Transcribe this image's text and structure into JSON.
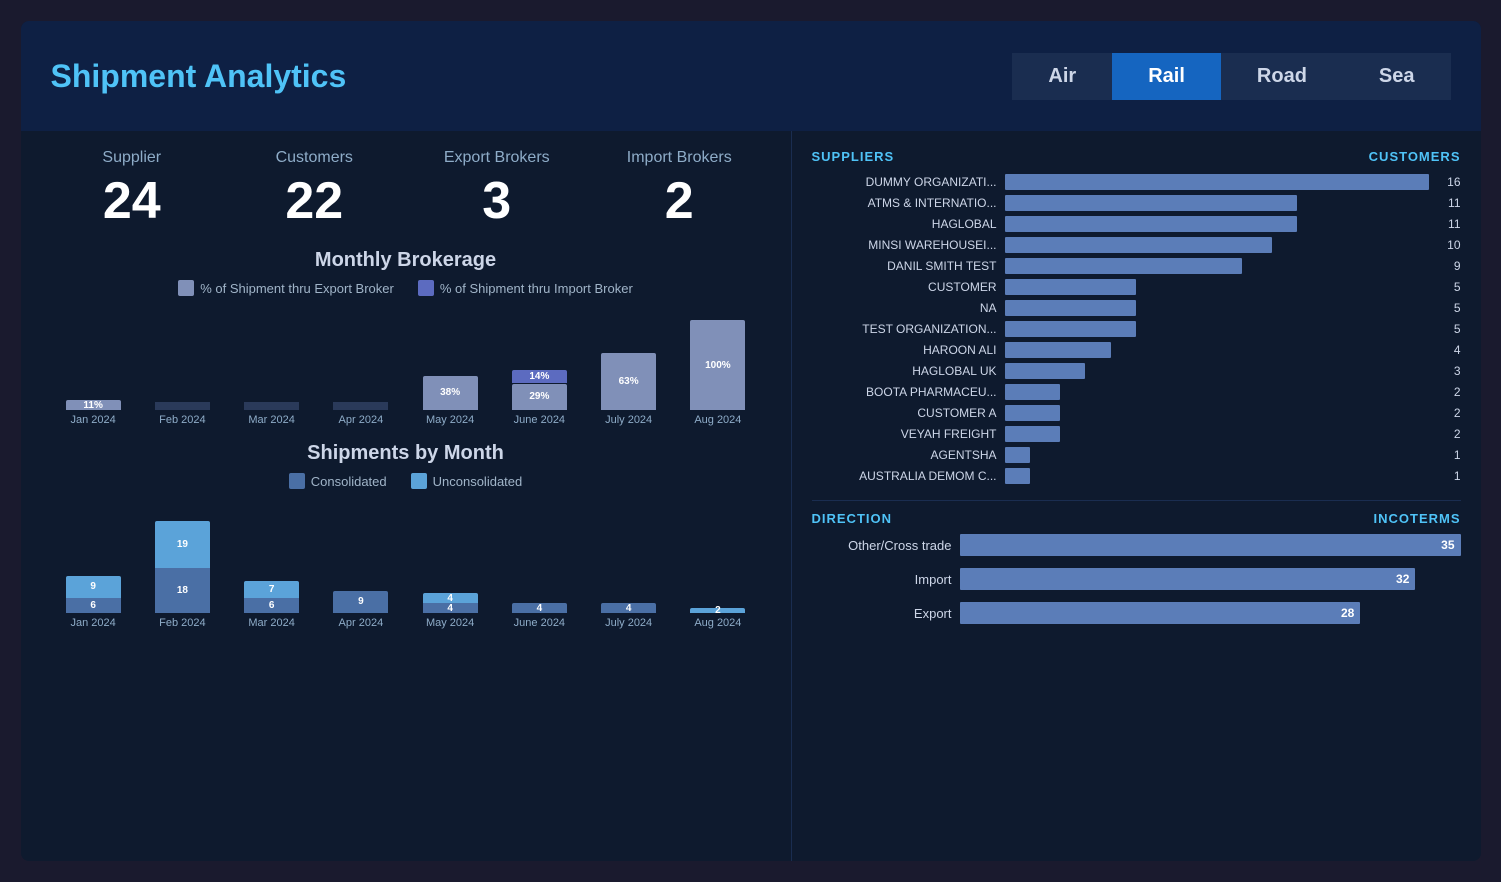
{
  "header": {
    "title": "Shipment Analytics",
    "nav_tabs": [
      {
        "label": "Air",
        "active": false
      },
      {
        "label": "Rail",
        "active": true
      },
      {
        "label": "Road",
        "active": false
      },
      {
        "label": "Sea",
        "active": false
      }
    ]
  },
  "stats": [
    {
      "label": "Supplier",
      "value": "24"
    },
    {
      "label": "Customers",
      "value": "22"
    },
    {
      "label": "Export Brokers",
      "value": "3"
    },
    {
      "label": "Import Brokers",
      "value": "2"
    }
  ],
  "brokerage_chart": {
    "title": "Monthly Brokerage",
    "legend": [
      {
        "label": "% of Shipment thru Export Broker",
        "color": "#8090b8"
      },
      {
        "label": "% of Shipment thru Import Broker",
        "color": "#5c6bc0"
      }
    ],
    "bars": [
      {
        "month": "Jan 2024",
        "export_pct": 11,
        "import_pct": 0,
        "export_label": "11%",
        "import_label": ""
      },
      {
        "month": "Feb 2024",
        "export_pct": 0,
        "import_pct": 0,
        "export_label": "",
        "import_label": ""
      },
      {
        "month": "Mar 2024",
        "export_pct": 0,
        "import_pct": 0,
        "export_label": "",
        "import_label": ""
      },
      {
        "month": "Apr 2024",
        "export_pct": 0,
        "import_pct": 0,
        "export_label": "",
        "import_label": ""
      },
      {
        "month": "May 2024",
        "export_pct": 38,
        "import_pct": 0,
        "export_label": "38%",
        "import_label": ""
      },
      {
        "month": "June 2024",
        "export_pct": 29,
        "import_pct": 14,
        "export_label": "29%",
        "import_label": "14%"
      },
      {
        "month": "July 2024",
        "export_pct": 63,
        "import_pct": 0,
        "export_label": "63%",
        "import_label": ""
      },
      {
        "month": "Aug 2024",
        "export_pct": 100,
        "import_pct": 0,
        "export_label": "100%",
        "import_label": ""
      }
    ]
  },
  "shipments_chart": {
    "title": "Shipments by Month",
    "legend": [
      {
        "label": "Consolidated",
        "color": "#4a6fa5"
      },
      {
        "label": "Unconsolidated",
        "color": "#5ba3d9"
      }
    ],
    "bars": [
      {
        "month": "Jan 2024",
        "consolidated": 6,
        "unconsolidated": 9
      },
      {
        "month": "Feb 2024",
        "consolidated": 18,
        "unconsolidated": 19
      },
      {
        "month": "Mar 2024",
        "consolidated": 6,
        "unconsolidated": 7
      },
      {
        "month": "Apr 2024",
        "consolidated": 9,
        "unconsolidated": 0
      },
      {
        "month": "May 2024",
        "consolidated": 4,
        "unconsolidated": 4
      },
      {
        "month": "June 2024",
        "consolidated": 4,
        "unconsolidated": 0
      },
      {
        "month": "July 2024",
        "consolidated": 4,
        "unconsolidated": 0
      },
      {
        "month": "Aug 2024",
        "consolidated": 0,
        "unconsolidated": 2
      }
    ]
  },
  "right_panel": {
    "suppliers_label": "SUPPLIERS",
    "customers_label": "CUSTOMERS",
    "suppliers": [
      {
        "name": "DUMMY ORGANIZATI...",
        "count": 16,
        "bar_pct": 100
      },
      {
        "name": "ATMS & INTERNATIO...",
        "count": 11,
        "bar_pct": 69
      },
      {
        "name": "HAGLOBAL",
        "count": 11,
        "bar_pct": 69
      },
      {
        "name": "MINSI WAREHOUSEI...",
        "count": 10,
        "bar_pct": 63
      },
      {
        "name": "DANIL SMITH TEST",
        "count": 9,
        "bar_pct": 56
      },
      {
        "name": "CUSTOMER",
        "count": 5,
        "bar_pct": 31
      },
      {
        "name": "NA",
        "count": 5,
        "bar_pct": 31
      },
      {
        "name": "TEST ORGANIZATION...",
        "count": 5,
        "bar_pct": 31
      },
      {
        "name": "HAROON ALI",
        "count": 4,
        "bar_pct": 25
      },
      {
        "name": "HAGLOBAL UK",
        "count": 3,
        "bar_pct": 19
      },
      {
        "name": "BOOTA PHARMACEU...",
        "count": 2,
        "bar_pct": 13
      },
      {
        "name": "CUSTOMER A",
        "count": 2,
        "bar_pct": 13
      },
      {
        "name": "VEYAH FREIGHT",
        "count": 2,
        "bar_pct": 13
      },
      {
        "name": "AGENTSHA",
        "count": 1,
        "bar_pct": 6
      },
      {
        "name": "AUSTRALIA DEMOM C...",
        "count": 1,
        "bar_pct": 6
      }
    ],
    "direction_label": "DIRECTION",
    "incoterms_label": "INCOTERMS",
    "directions": [
      {
        "name": "Other/Cross trade",
        "count": 35,
        "bar_pct": 100
      },
      {
        "name": "Import",
        "count": 32,
        "bar_pct": 91
      },
      {
        "name": "Export",
        "count": 28,
        "bar_pct": 80
      }
    ]
  },
  "colors": {
    "export_bar": "#8090b8",
    "import_bar": "#5c6bc0",
    "consolidated_bar": "#4a6fa5",
    "unconsolidated_bar": "#5ba3d9",
    "supplier_bar": "#5b7db8",
    "direction_bar": "#5b7db8",
    "accent": "#4fc3f7",
    "bg_dark": "#0e1a2e",
    "bg_header": "#0e2044",
    "tab_active": "#1565c0"
  }
}
